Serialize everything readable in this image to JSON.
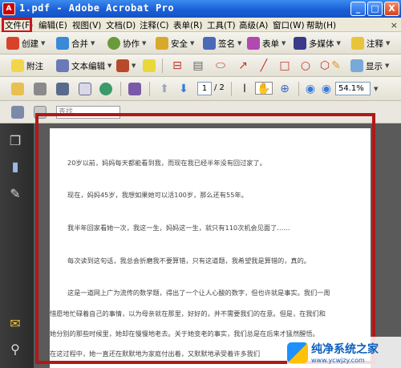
{
  "window": {
    "title": "1.pdf - Adobe Acrobat Pro",
    "app_icon": "acrobat-icon",
    "controls": [
      "_",
      "□",
      "X"
    ]
  },
  "menubar": {
    "items": [
      "文件(F)",
      "编辑(E)",
      "视图(V)",
      "文档(D)",
      "注释(C)",
      "表单(R)",
      "工具(T)",
      "高级(A)",
      "窗口(W)",
      "帮助(H)"
    ],
    "close_glyph": "×"
  },
  "toolbar1": {
    "create": "创建",
    "combine": "合并",
    "collaborate": "协作",
    "secure": "安全",
    "sign": "签名",
    "forms": "表单",
    "multimedia": "多媒体",
    "comment": "注释"
  },
  "toolbar2": {
    "sticky_note": "附注",
    "text_edits": "文本编辑",
    "show": "显示"
  },
  "toolbar3": {
    "page_current": "1",
    "page_total": "/ 2",
    "zoom": "54.1%"
  },
  "toolbar4": {
    "search_placeholder": "查找"
  },
  "document": {
    "paragraphs": [
      "20岁以前，妈妈每天都能看到我，而现在我已经半年没有回过家了。",
      "现在，妈妈45岁，我想如果她可以活100岁，那么还有55年。",
      "我半年回家看她一次，我这一生，妈妈这一生，就只有110次机会见面了……",
      "每次读到这句话，我总会折磨我不要算错，只有这道题，我希望我是算错的，真的。",
      "这是一道网上广为流传的数学题，得出了一个让人心酸的数字，但也许就是事实。我们一周",
      "惜愿地忙碌着自己的事情，以为母亲就在那里，好好的，并不需要我们的在意。但是，在我们和",
      "她分别的那些时候里，她却在慢慢地老去。关于她变老的事实，我们总是在后来才猛然醒悟。",
      "在这过程中，她一直还在默默地为家庭付出着，又默默地承受着许多我们"
    ]
  },
  "watermark": {
    "main": "纯净系统之家",
    "sub": "www.ycwjzy.com"
  },
  "colors": {
    "annotation_red": "#b01818",
    "titlebar_blue": "#1a5fd6"
  }
}
